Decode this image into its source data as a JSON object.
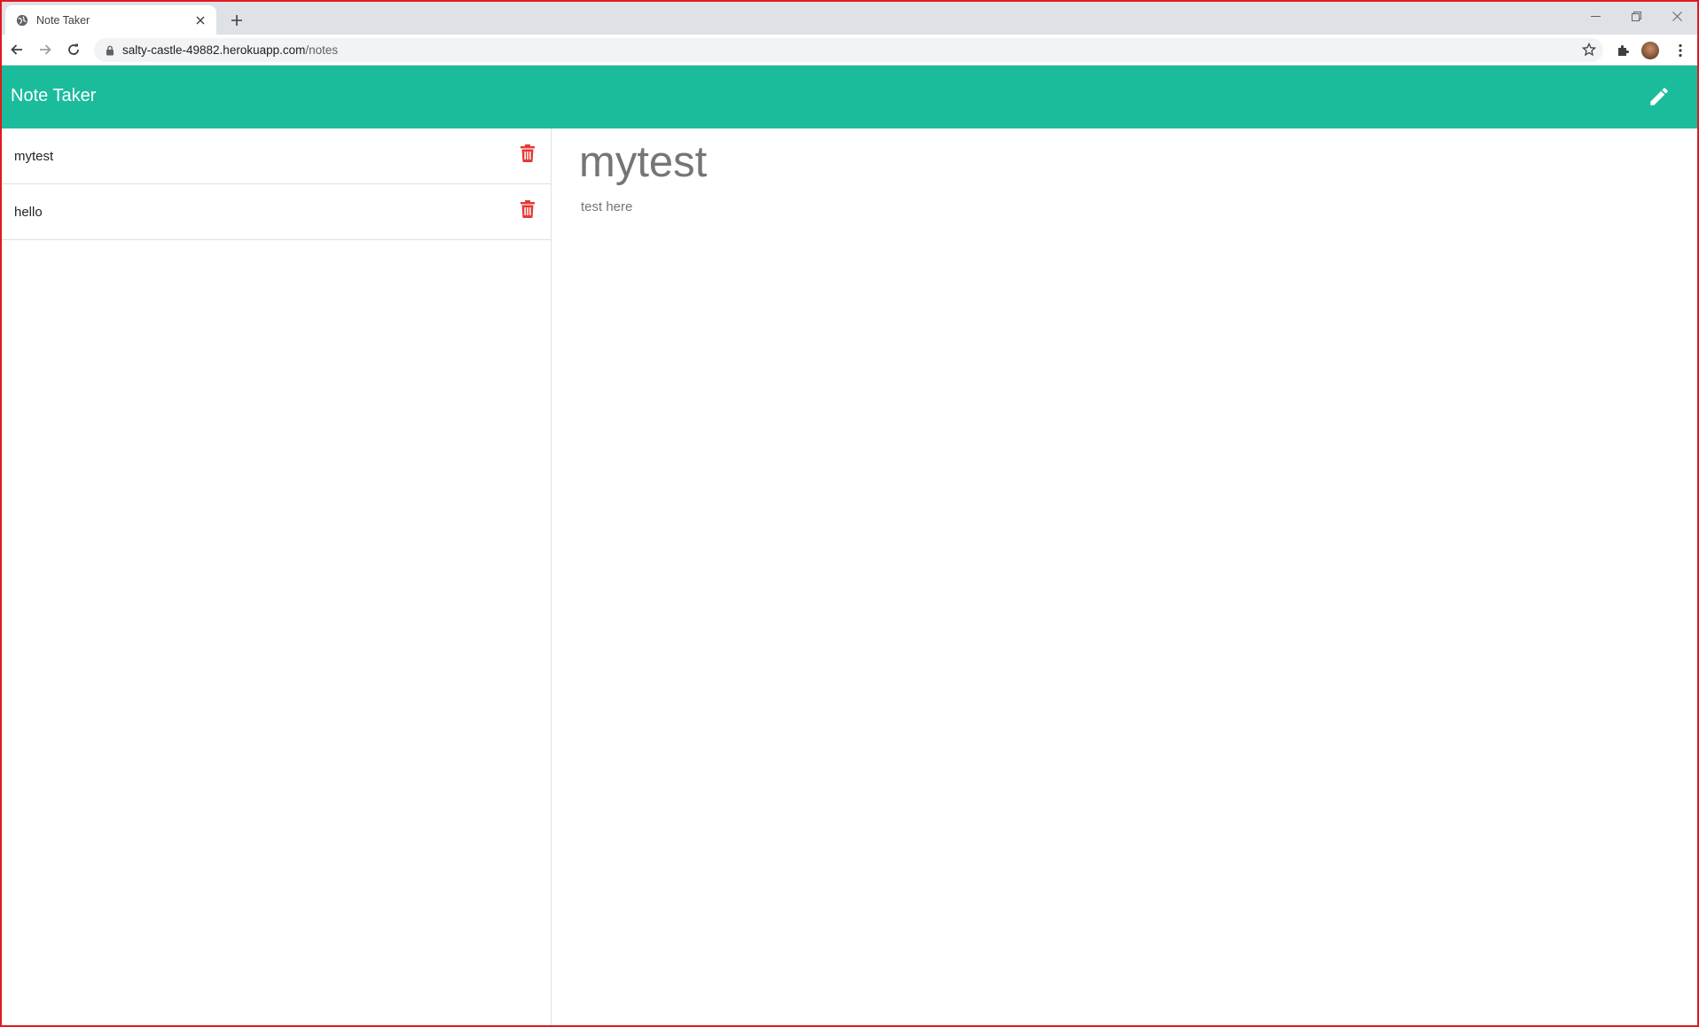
{
  "browser": {
    "tab_title": "Note Taker",
    "url_host": "salty-castle-49882.herokuapp.com",
    "url_path": "/notes"
  },
  "app": {
    "title": "Note Taker",
    "new_note_icon": "pencil-icon",
    "accent_color": "#1abc9c",
    "delete_color": "#e53935"
  },
  "notes": [
    {
      "title": "mytest"
    },
    {
      "title": "hello"
    }
  ],
  "active_note": {
    "title": "mytest",
    "text": "test here"
  }
}
